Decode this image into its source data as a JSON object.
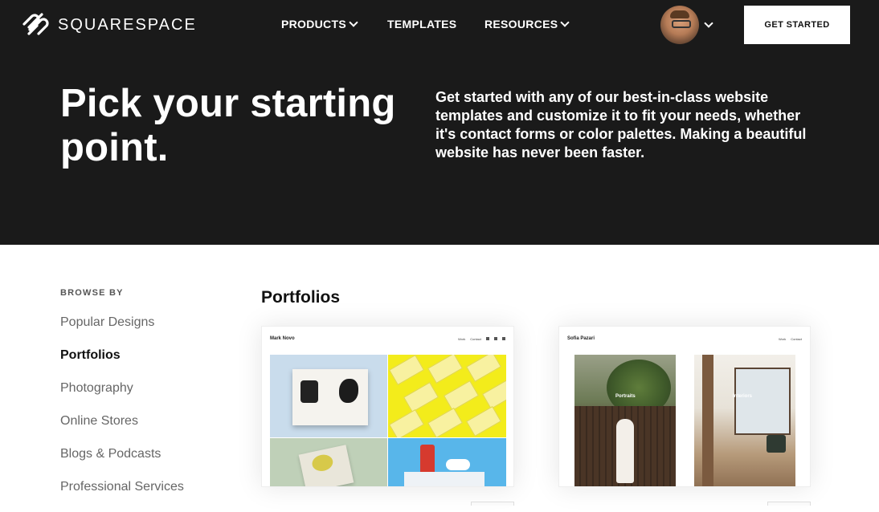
{
  "nav": {
    "logo_text": "SQUARESPACE",
    "items": [
      {
        "label": "PRODUCTS",
        "has_dropdown": true
      },
      {
        "label": "TEMPLATES",
        "has_dropdown": false
      },
      {
        "label": "RESOURCES",
        "has_dropdown": true
      }
    ],
    "cta_label": "GET STARTED"
  },
  "hero": {
    "title": "Pick your starting point.",
    "subtitle": "Get started with any of our best-in-class website templates and customize it to fit your needs, whether it's contact forms or color palettes. Making a beautiful website has never been faster."
  },
  "sidebar": {
    "label": "BROWSE BY",
    "items": [
      {
        "label": "Popular Designs",
        "active": false
      },
      {
        "label": "Portfolios",
        "active": true
      },
      {
        "label": "Photography",
        "active": false
      },
      {
        "label": "Online Stores",
        "active": false
      },
      {
        "label": "Blogs & Podcasts",
        "active": false
      },
      {
        "label": "Professional Services",
        "active": false
      }
    ]
  },
  "main": {
    "section_title": "Portfolios",
    "cards": [
      {
        "brand": "Mark Novo",
        "links": [
          "Work",
          "Contact"
        ]
      },
      {
        "brand": "Sofia Pazari",
        "links": [
          "Work",
          "Contact"
        ],
        "overlays": [
          "Portraits",
          "Interiors"
        ]
      }
    ]
  },
  "colors": {
    "hero_bg": "#1a1a1a",
    "accent_yellow": "#f3ec1b",
    "text_active": "#111111",
    "text_muted": "#666666"
  },
  "icons": {
    "logo": "squarespace-logo-icon",
    "dropdown": "chevron-down-icon"
  }
}
